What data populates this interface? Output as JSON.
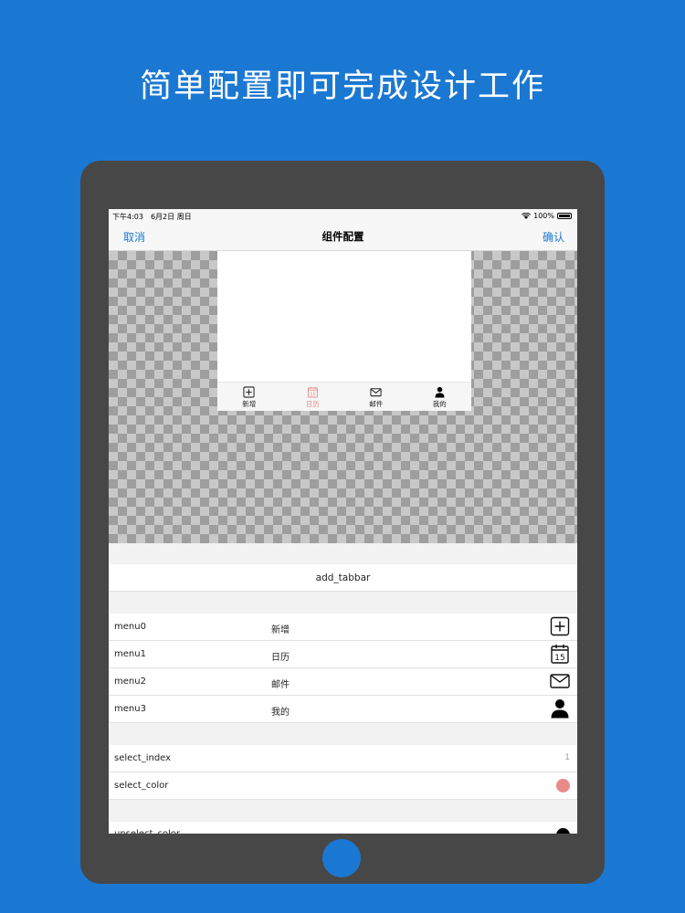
{
  "headline": "简单配置即可完成设计工作",
  "status_bar": {
    "time_date": "下午4:03　6月2日 周日",
    "battery": "100%"
  },
  "nav": {
    "cancel": "取消",
    "title": "组件配置",
    "confirm": "确认"
  },
  "preview_tabs": [
    {
      "label": "新增",
      "icon": "add-square-icon",
      "active": false
    },
    {
      "label": "日历",
      "icon": "calendar-icon",
      "active": true
    },
    {
      "label": "邮件",
      "icon": "mail-icon",
      "active": false
    },
    {
      "label": "我的",
      "icon": "person-icon",
      "active": false
    }
  ],
  "add_button": "add_tabbar",
  "menus": [
    {
      "key": "menu0",
      "value": "新增",
      "icon": "add-square-icon"
    },
    {
      "key": "menu1",
      "value": "日历",
      "icon": "calendar-icon"
    },
    {
      "key": "menu2",
      "value": "邮件",
      "icon": "mail-icon"
    },
    {
      "key": "menu3",
      "value": "我的",
      "icon": "person-icon"
    }
  ],
  "calendar_day": "15",
  "select_index": {
    "key": "select_index",
    "value": "1"
  },
  "select_color": {
    "key": "select_color",
    "color": "#e88a8a"
  },
  "unselect_color": {
    "key": "unselect_color",
    "color": "#000000"
  },
  "colors": {
    "background": "#1b78d2",
    "accent": "#1b78d2",
    "device": "#474747"
  }
}
